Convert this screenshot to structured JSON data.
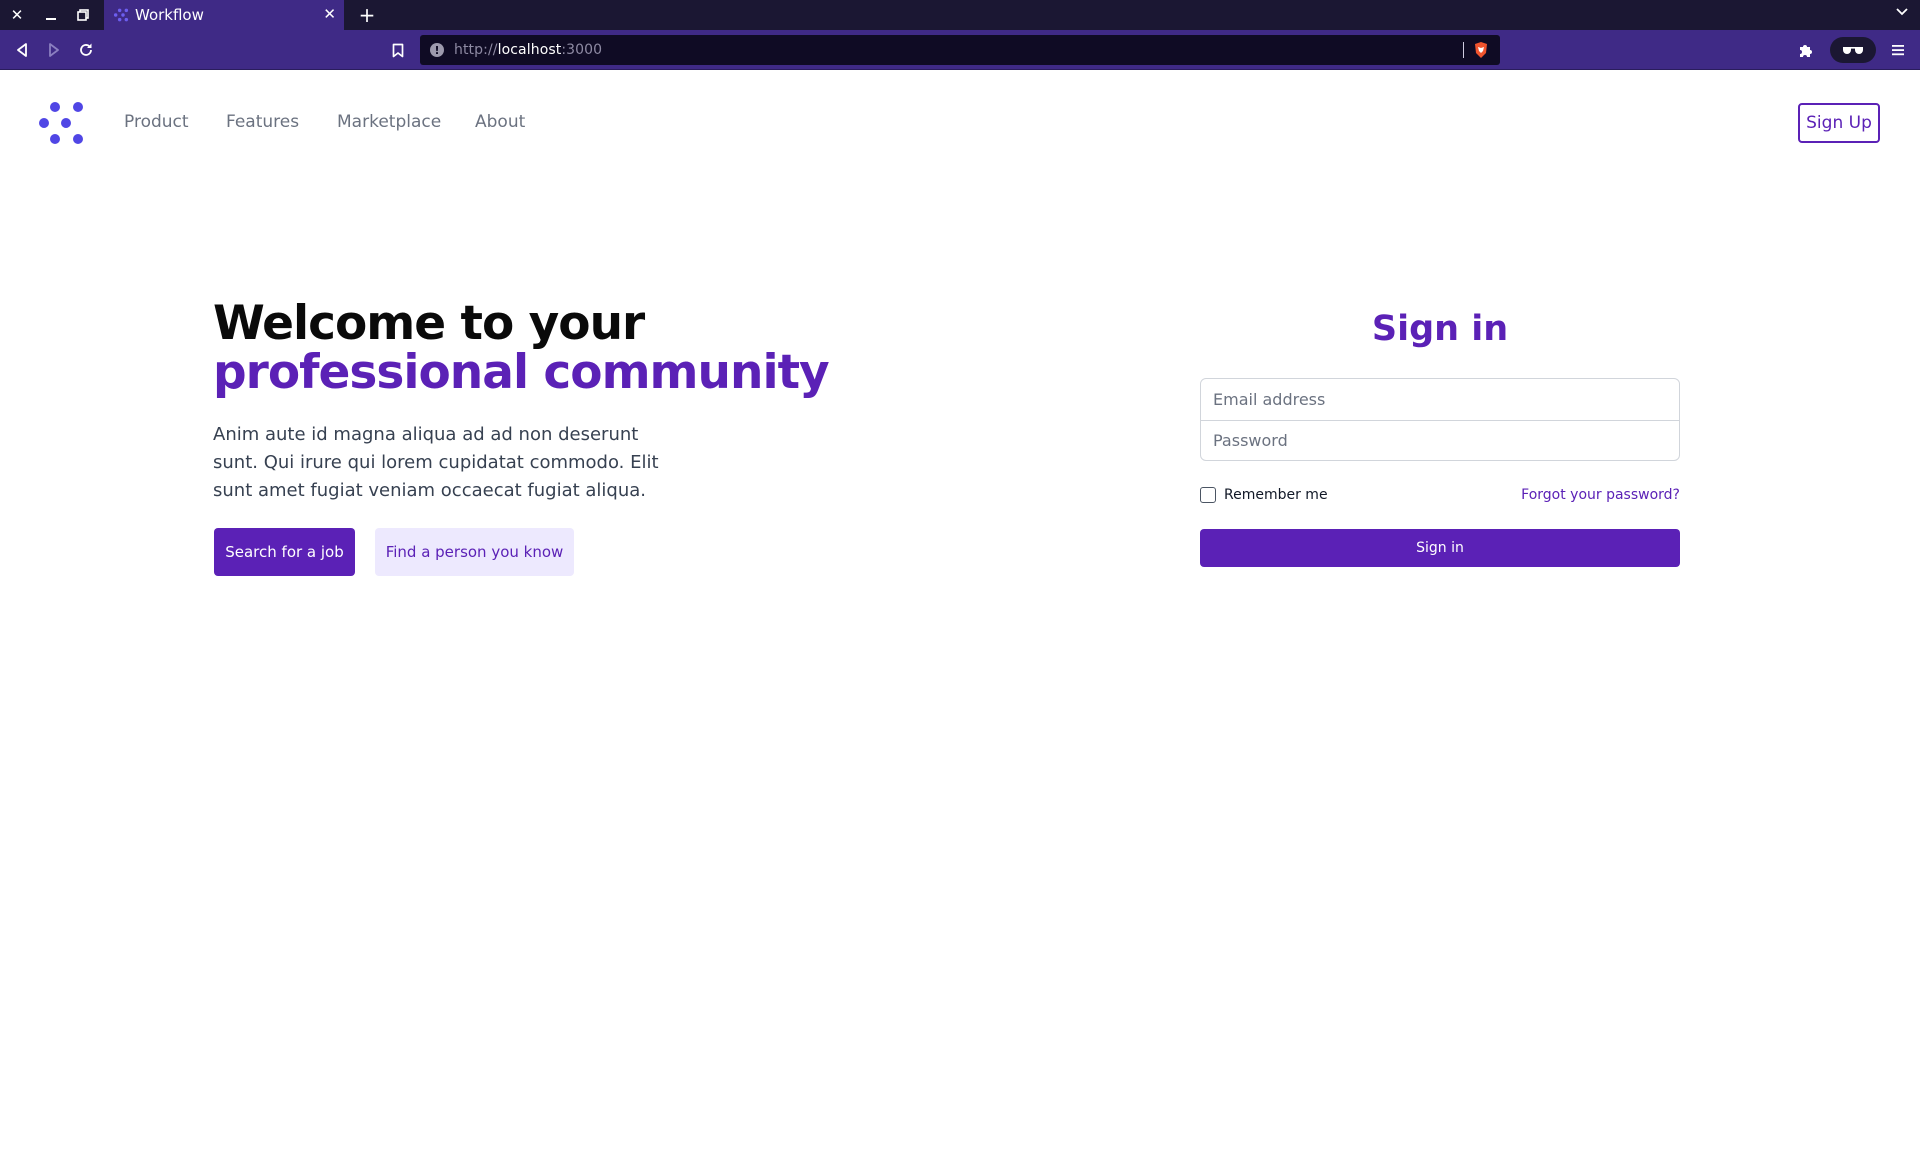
{
  "browser": {
    "tab_title": "Workflow",
    "url_scheme": "http://",
    "url_host": "localhost",
    "url_port": ":3000",
    "icons": {
      "close_window": "close-icon",
      "minimize": "minimize-icon",
      "restore": "restore-icon",
      "new_tab": "plus-icon",
      "tab_menu": "chevron-down-icon",
      "back": "back-arrow-icon",
      "forward": "forward-arrow-icon",
      "reload": "reload-icon",
      "bookmark": "bookmark-icon",
      "site_info": "info-icon",
      "shields": "brave-shield-icon",
      "extensions": "puzzle-icon",
      "reader": "glasses-icon",
      "menu": "hamburger-icon"
    }
  },
  "site_nav": {
    "logo_icon": "workflow-logo-icon",
    "links": [
      "Product",
      "Features",
      "Marketplace",
      "About"
    ],
    "signup_label": "Sign Up"
  },
  "hero": {
    "title_line1": "Welcome to your",
    "title_line2": "professional community",
    "description": "Anim aute id magna aliqua ad ad non deserunt sunt. Qui irure qui lorem cupidatat commodo. Elit sunt amet fugiat veniam occaecat fugiat aliqua.",
    "primary_button": "Search for a job",
    "secondary_button": "Find a person you know"
  },
  "signin": {
    "title": "Sign in",
    "email_placeholder": "Email address",
    "password_placeholder": "Password",
    "remember_label": "Remember me",
    "remember_checked": false,
    "forgot_link": "Forgot your password?",
    "submit_label": "Sign in"
  },
  "colors": {
    "brand": "#5b21b6",
    "brand_light": "#ede9fe",
    "logo": "#5046e5",
    "chrome_dark": "#1b1733",
    "chrome_toolbar": "#3f2a86"
  }
}
